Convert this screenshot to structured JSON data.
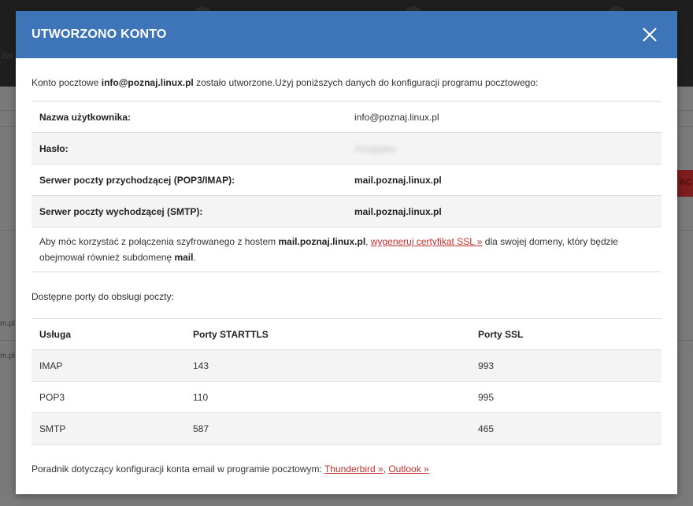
{
  "modal": {
    "title": "UTWORZONO KONTO",
    "close_icon": "close-icon"
  },
  "intro": {
    "prefix": "Konto pocztowe ",
    "email": "info@poznaj.linux.pl",
    "suffix": " zostało utworzone.Użyj poniższych danych do konfiguracji programu pocztowego:"
  },
  "credentials": [
    {
      "label": "Nazwa użytkownika:",
      "value": "info@poznaj.linux.pl"
    },
    {
      "label": "Hasło:",
      "value": "Xrzqjrgwu"
    },
    {
      "label": "Serwer poczty przychodzącej (POP3/IMAP):",
      "value": "mail.poznaj.linux.pl"
    },
    {
      "label": "Serwer poczty wychodzącej (SMTP):",
      "value": "mail.poznaj.linux.pl"
    }
  ],
  "ssl_note": {
    "part1": "Aby móc korzystać z połączenia szyfrowanego z hostem ",
    "host": "mail.poznaj.linux.pl",
    "part2": ", ",
    "link": "wygeneruj certyfikat SSL »",
    "part3": " dla swojej domeny, który będzie obejmował również subdomenę ",
    "subdomain": "mail",
    "part4": "."
  },
  "ports_caption": "Dostępne porty do obsługi poczty:",
  "ports": {
    "headers": [
      "Usługa",
      "Porty STARTTLS",
      "Porty SSL"
    ],
    "rows": [
      [
        "IMAP",
        "143",
        "993"
      ],
      [
        "POP3",
        "110",
        "995"
      ],
      [
        "SMTP",
        "587",
        "465"
      ]
    ]
  },
  "guide": {
    "text": "Poradnik dotyczący konfiguracji konta email w programie pocztowym: ",
    "link1": "Thunderbird »",
    "sep": ", ",
    "link2": "Outlook »"
  },
  "background": {
    "side_text_1": "Zar",
    "side_text_2": "m.pl",
    "side_text_3": "m.pl",
    "red_button_text": "AC"
  },
  "colors": {
    "header_bg": "#3e75b9",
    "link_red": "#c0312e"
  }
}
